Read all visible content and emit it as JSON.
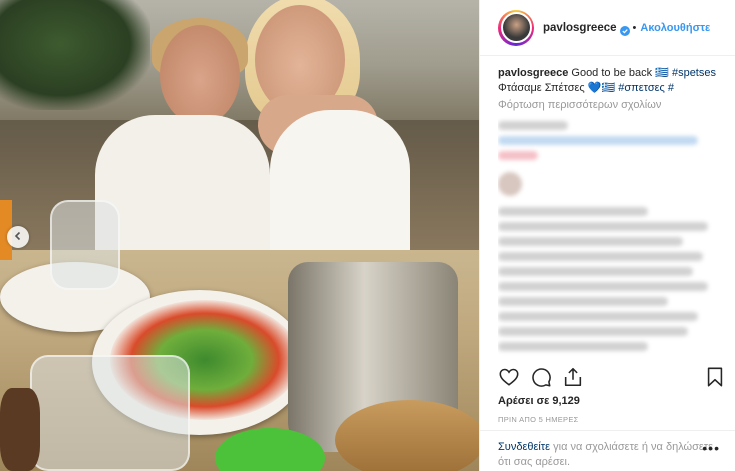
{
  "post": {
    "username": "pavlosgreece",
    "follow_label": "Ακολουθήστε",
    "separator": "•",
    "caption_username": "pavlosgreece",
    "caption_text": "Good to be back",
    "caption_flag1": "🇬🇷",
    "caption_tag1": "#spetses",
    "caption_line2": "Φτάσαμε Σπέτσες",
    "caption_heart": "💙",
    "caption_flag2": "🇬🇷",
    "caption_tag2": "#σπετσες",
    "caption_tag3": "#",
    "load_more_label": "Φόρτωση περισσότερων σχολίων",
    "likes_label": "Αρέσει σε 9,129",
    "time_ago": "ΠΡΙΝ ΑΠΟ 5 ΗΜΕΡΕΣ",
    "login_link": "Συνδεθείτε",
    "login_text": " για να σχολιάσετε ή να δηλώσετε ότι σας αρέσει.",
    "more_label": "•••"
  },
  "icons": {
    "verified": "verified-badge-icon",
    "like": "heart-icon",
    "comment": "comment-icon",
    "share": "share-icon",
    "save": "bookmark-icon",
    "carousel_prev": "chevron-left-icon"
  },
  "colors": {
    "link_blue": "#3897f0",
    "hashtag_navy": "#003569",
    "muted_gray": "#999999",
    "text": "#262626"
  }
}
